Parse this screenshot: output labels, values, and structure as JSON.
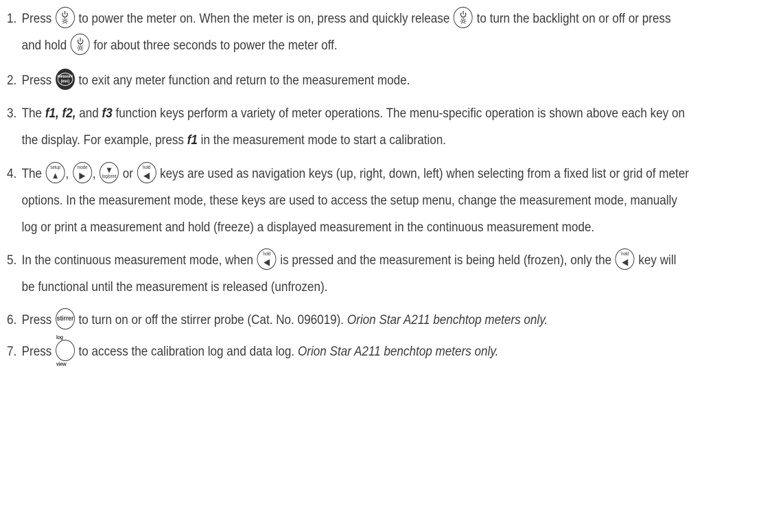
{
  "items": [
    {
      "num": "1.",
      "a": "Press",
      "b": "to power the meter on. When the meter is on, press and quickly release",
      "c": "to turn the backlight on or off or press and hold",
      "d": "for about three seconds to power the meter off."
    },
    {
      "num": "2.",
      "a": "Press",
      "b": "to exit any meter function and return to the measurement mode."
    },
    {
      "num": "3.",
      "a": "The",
      "f_keys": "f1, f2,",
      "and": "and",
      "f3": "f3",
      "b": "function keys perform a variety of meter operations. The menu-specific operation is shown above each key on the display. For example, press",
      "f1": "f1",
      "c": "in the measurement mode to start a calibration."
    },
    {
      "num": "4.",
      "a": "The",
      "sep1": ",",
      "sep2": ",",
      "or": "or",
      "b": "keys are used as navigation keys (up, right, down, left) when selecting from a fixed list or grid of meter options. In the measurement mode, these keys are used to access the setup menu, change the measurement mode, manually log or print a measurement and hold (freeze) a displayed measurement in the continuous measurement mode."
    },
    {
      "num": "5.",
      "a": "In the continuous measurement mode, when",
      "b": "is pressed and the measurement is being held (frozen), only the",
      "c": "key will be functional until the measurement is released (unfrozen)."
    },
    {
      "num": "6.",
      "a": "Press",
      "b": "to turn on or off the stirrer probe (Cat. No. 096019).",
      "note": "Orion Star A211 benchtop meters only."
    },
    {
      "num": "7.",
      "a": "Press",
      "b": "to access the calibration log and data log.",
      "note": "Orion Star A211 benchtop meters only."
    }
  ],
  "keys": {
    "measure_top": "measure",
    "measure_bottom": "(esc)",
    "setup": "setup",
    "mode": "mode",
    "logprint": "log/print",
    "hold": "hold",
    "stirrer": "stirrer",
    "logview": "log view",
    "icons": {
      "power": "power-backlight-icon",
      "up": "up-arrow-icon",
      "right": "right-arrow-icon",
      "down": "down-arrow-icon",
      "left": "left-arrow-icon"
    }
  }
}
